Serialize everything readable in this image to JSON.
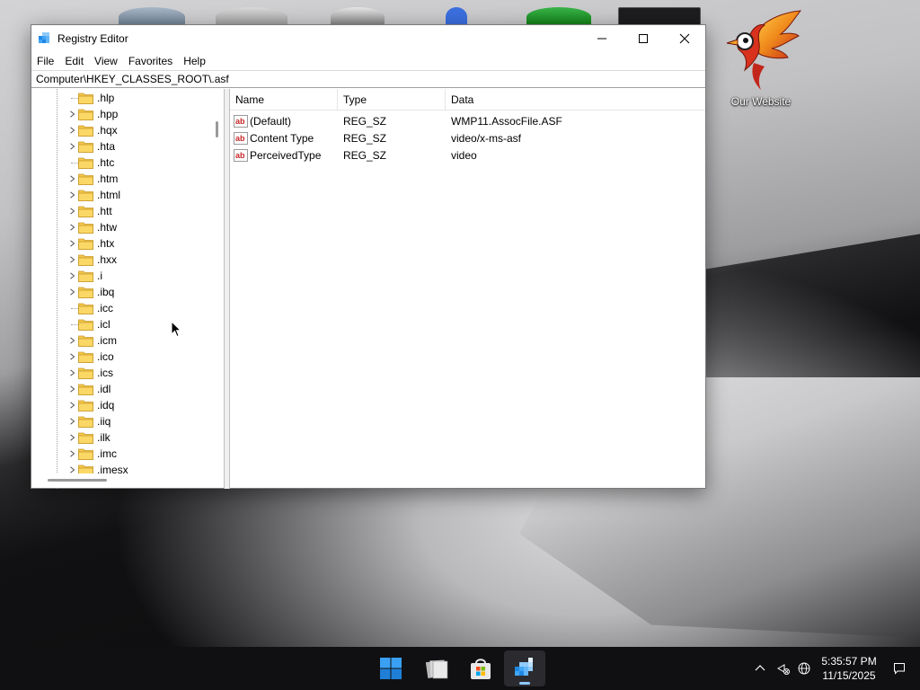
{
  "window": {
    "title": "Registry Editor",
    "app_icon": "registry-editor-icon",
    "caption_buttons": [
      "minimize-icon",
      "maximize-icon",
      "close-icon"
    ]
  },
  "menu": {
    "items": [
      "File",
      "Edit",
      "View",
      "Favorites",
      "Help"
    ]
  },
  "address": {
    "path": "Computer\\HKEY_CLASSES_ROOT\\.asf"
  },
  "tree": {
    "items": [
      {
        "label": ".hlp",
        "expandable": false
      },
      {
        "label": ".hpp",
        "expandable": true
      },
      {
        "label": ".hqx",
        "expandable": true
      },
      {
        "label": ".hta",
        "expandable": true
      },
      {
        "label": ".htc",
        "expandable": false
      },
      {
        "label": ".htm",
        "expandable": true
      },
      {
        "label": ".html",
        "expandable": true
      },
      {
        "label": ".htt",
        "expandable": true
      },
      {
        "label": ".htw",
        "expandable": true
      },
      {
        "label": ".htx",
        "expandable": true
      },
      {
        "label": ".hxx",
        "expandable": true
      },
      {
        "label": ".i",
        "expandable": true
      },
      {
        "label": ".ibq",
        "expandable": true
      },
      {
        "label": ".icc",
        "expandable": false
      },
      {
        "label": ".icl",
        "expandable": false
      },
      {
        "label": ".icm",
        "expandable": true
      },
      {
        "label": ".ico",
        "expandable": true
      },
      {
        "label": ".ics",
        "expandable": true
      },
      {
        "label": ".idl",
        "expandable": true
      },
      {
        "label": ".idq",
        "expandable": true
      },
      {
        "label": ".iiq",
        "expandable": true
      },
      {
        "label": ".ilk",
        "expandable": true
      },
      {
        "label": ".imc",
        "expandable": true
      },
      {
        "label": ".imesx",
        "expandable": true
      }
    ]
  },
  "values": {
    "columns": {
      "name": "Name",
      "type": "Type",
      "data": "Data"
    },
    "rows": [
      {
        "name": "(Default)",
        "type": "REG_SZ",
        "data": "WMP11.AssocFile.ASF"
      },
      {
        "name": "Content Type",
        "type": "REG_SZ",
        "data": "video/x-ms-asf"
      },
      {
        "name": "PerceivedType",
        "type": "REG_SZ",
        "data": "video"
      }
    ]
  },
  "desktop": {
    "shortcut_label": "Our Website",
    "shortcut_icon": "phoenix-logo-icon"
  },
  "taskbar": {
    "apps": [
      "start-icon",
      "file-explorer-icon",
      "microsoft-store-icon",
      "registry-editor-icon"
    ],
    "tray_icons": [
      "chevron-up-icon",
      "network-icon",
      "language-globe-icon",
      "notification-icon"
    ],
    "time": "5:35:57 PM",
    "date": "11/15/2025"
  },
  "colors": {
    "folder": "#f4c84a",
    "taskbar": "#101012",
    "accent": "#0078d4"
  }
}
